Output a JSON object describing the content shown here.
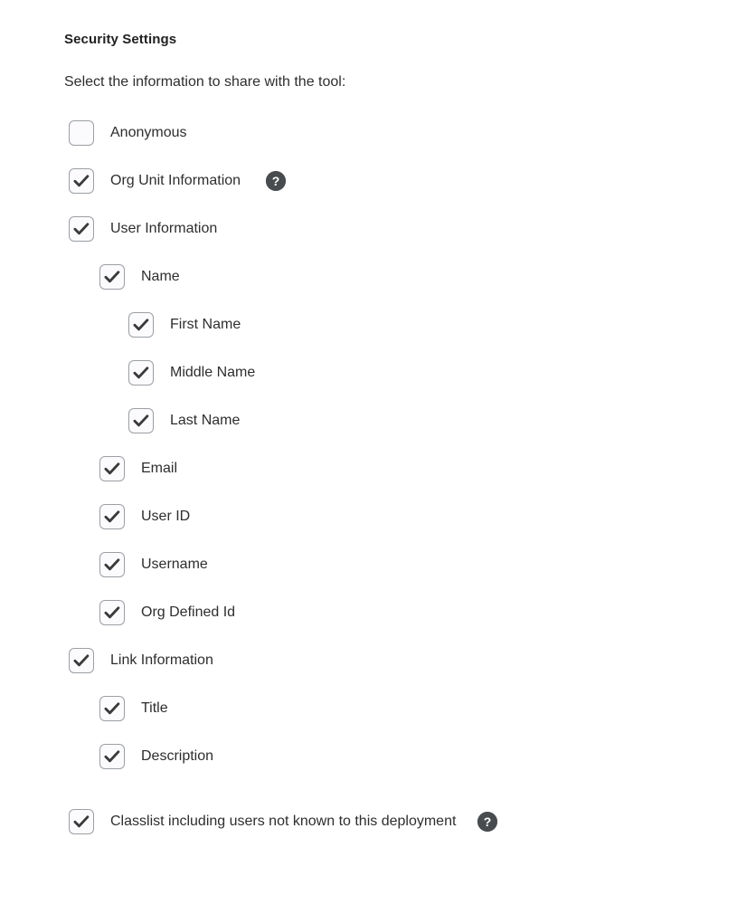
{
  "section": {
    "title": "Security Settings",
    "description": "Select the information to share with the tool:"
  },
  "help_icon": {
    "name": "help-icon",
    "glyph": "?",
    "color": "#494c4e"
  },
  "colors": {
    "text": "#2e2e2e",
    "heading": "#202122",
    "checkbox_border": "#9b9fa3",
    "checkbox_fill": "#fbfbfd",
    "checkmark": "#3a3a3a",
    "help_circle": "#494c4e",
    "background": "#ffffff"
  },
  "items": [
    {
      "id": "anonymous",
      "label": "Anonymous",
      "level": 1,
      "checked": false,
      "help": false,
      "spaced": false
    },
    {
      "id": "org-unit-info",
      "label": "Org Unit Information",
      "level": 1,
      "checked": true,
      "help": true,
      "spaced": false
    },
    {
      "id": "user-info",
      "label": "User Information",
      "level": 1,
      "checked": true,
      "help": false,
      "spaced": false
    },
    {
      "id": "name",
      "label": "Name",
      "level": 2,
      "checked": true,
      "help": false,
      "spaced": false
    },
    {
      "id": "first-name",
      "label": "First Name",
      "level": 3,
      "checked": true,
      "help": false,
      "spaced": false
    },
    {
      "id": "middle-name",
      "label": "Middle Name",
      "level": 3,
      "checked": true,
      "help": false,
      "spaced": false
    },
    {
      "id": "last-name",
      "label": "Last Name",
      "level": 3,
      "checked": true,
      "help": false,
      "spaced": false
    },
    {
      "id": "email",
      "label": "Email",
      "level": 2,
      "checked": true,
      "help": false,
      "spaced": false
    },
    {
      "id": "user-id",
      "label": "User ID",
      "level": 2,
      "checked": true,
      "help": false,
      "spaced": false
    },
    {
      "id": "username",
      "label": "Username",
      "level": 2,
      "checked": true,
      "help": false,
      "spaced": false
    },
    {
      "id": "org-defined-id",
      "label": "Org Defined Id",
      "level": 2,
      "checked": true,
      "help": false,
      "spaced": false
    },
    {
      "id": "link-info",
      "label": "Link Information",
      "level": 1,
      "checked": true,
      "help": false,
      "spaced": false
    },
    {
      "id": "title",
      "label": "Title",
      "level": 2,
      "checked": true,
      "help": false,
      "spaced": false
    },
    {
      "id": "description",
      "label": "Description",
      "level": 2,
      "checked": true,
      "help": false,
      "spaced": false
    },
    {
      "id": "classlist",
      "label": "Classlist including users not known to this deployment",
      "level": 1,
      "checked": true,
      "help": true,
      "spaced": true
    }
  ]
}
